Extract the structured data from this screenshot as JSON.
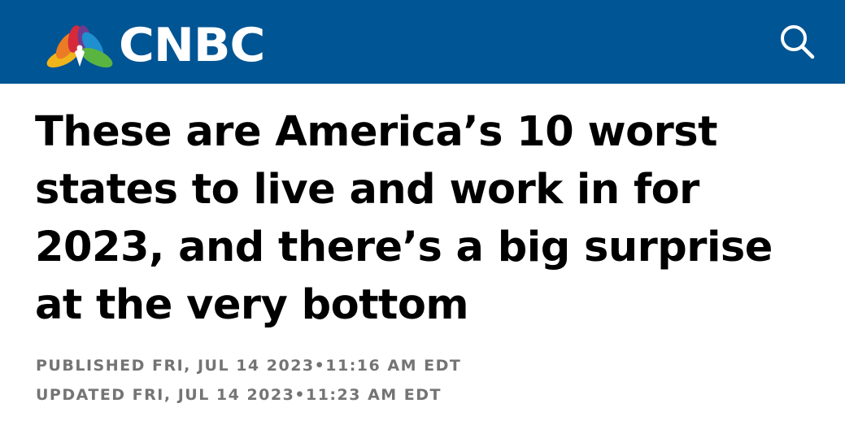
{
  "header": {
    "brand": "CNBC",
    "logo_icon": "nbc-peacock-icon",
    "search_icon": "search-icon",
    "background_color": "#005594"
  },
  "article": {
    "headline": "These are America’s 10 worst states to live and work in for 2023, and there’s a big surprise at the very bottom",
    "published": "PUBLISHED FRI, JUL 14 2023•11:16 AM EDT",
    "updated": "UPDATED FRI, JUL 14 2023•11:23 AM EDT"
  }
}
